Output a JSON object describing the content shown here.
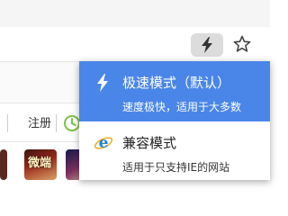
{
  "toolbar": {
    "mode_icon": "lightning-bolt-icon",
    "bookmark_icon": "star-icon"
  },
  "nav": {
    "register_label": "注册",
    "history_icon": "clock-icon"
  },
  "thumbnails": {
    "game_title": "微端"
  },
  "mode_menu": {
    "options": [
      {
        "title": "极速模式（默认）",
        "description": "速度极快，适用于大多数",
        "icon": "lightning-bolt-icon",
        "selected": true
      },
      {
        "title": "兼容模式",
        "description": "适用于只支持IE的网站",
        "icon": "ie-icon",
        "selected": false
      }
    ]
  },
  "colors": {
    "selected_bg": "#4a86e8",
    "button_bg": "#dcdcdc",
    "history_green": "#7cc243",
    "ie_blue": "#1e7fd6"
  }
}
